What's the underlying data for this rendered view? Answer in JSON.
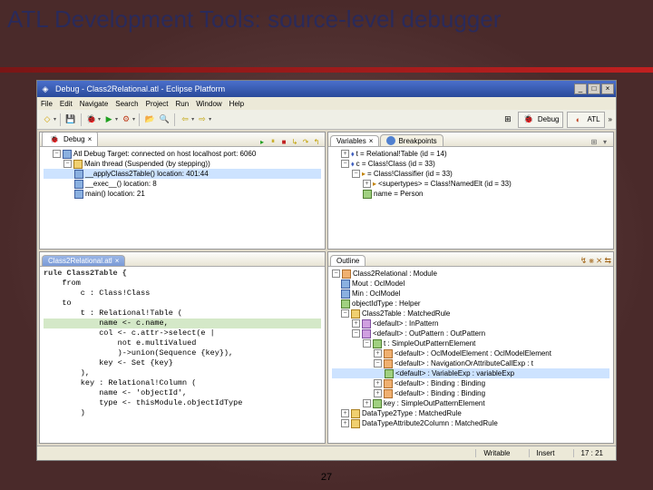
{
  "slide": {
    "title": "ATL Development Tools: source-level debugger",
    "page_number": "27"
  },
  "window": {
    "title": "Debug - Class2Relational.atl - Eclipse Platform",
    "win_min": "_",
    "win_max": "□",
    "win_close": "×"
  },
  "menu": {
    "file": "File",
    "edit": "Edit",
    "navigate": "Navigate",
    "search": "Search",
    "project": "Project",
    "run": "Run",
    "window": "Window",
    "help": "Help"
  },
  "toolbar": {
    "perspective_open_icon": "⊞",
    "debug_persp": "Debug",
    "atl_persp": "ATL",
    "more": "»"
  },
  "debug_view": {
    "tab_label": "Debug",
    "root": "Atl Debug Target: connected on host localhost port: 6060",
    "thread": "Main thread (Suspended (by stepping))",
    "frame1": "__applyClass2Table() location: 401:44",
    "frame2": "__exec__() location: 8",
    "frame3": "main() location: 21"
  },
  "vars_view": {
    "tab_vars": "Variables",
    "tab_bp": "Breakpoints",
    "v1": "t = Relational!Table (id = 14)",
    "v2": "c = Class!Class (id = 33)",
    "v3": "= Class!Classifier (id = 33)",
    "v4": "<supertypes> = Class!NamedElt (id = 33)",
    "v5": "name = Person"
  },
  "editor": {
    "tab_label": "Class2Relational.atl",
    "close_x": "×",
    "l1": "rule Class2Table {",
    "l2": "    from",
    "l3": "        c : Class!Class",
    "l4": "    to",
    "l5": "        t : Relational!Table (",
    "l6": "            name <- c.name,",
    "l7": "            col <- c.attr->select(e |",
    "l8": "                not e.multiValued",
    "l9": "                )->union(Sequence {key}),",
    "l10": "            key <- Set {key}",
    "l11": "        ),",
    "l12": "        key : Relational!Column (",
    "l13": "            name <- 'objectId',",
    "l14": "            type <- thisModule.objectIdType",
    "l15": "        )"
  },
  "outline": {
    "tab_label": "Outline",
    "n1": "Class2Relational : Module",
    "n2": "Mout : OclModel",
    "n3": "Min : OclModel",
    "n4": "objectIdType : Helper",
    "n5": "Class2Table : MatchedRule",
    "n6": "<default> : InPattern",
    "n7": "<default> : OutPattern : OutPattern",
    "n8": "t : SimpleOutPatternElement",
    "n9": "<default> : OclModelElement : OclModelElement",
    "n10": "<default> : NavigationOrAttributeCallExp : t",
    "n11": "<default> : VariableExp : variableExp",
    "n12": "<default> : Binding : Binding",
    "n13": "<default> : Binding : Binding",
    "n14": "key : SimpleOutPatternElement",
    "n15": "DataType2Type : MatchedRule",
    "n16": "DataTypeAttribute2Column : MatchedRule"
  },
  "status": {
    "writable": "Writable",
    "insert": "Insert",
    "pos": "17 : 21"
  }
}
